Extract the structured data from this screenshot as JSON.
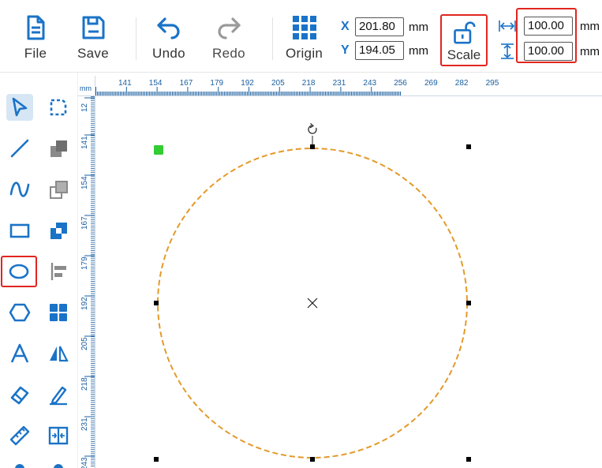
{
  "toolbar": {
    "file_label": "File",
    "save_label": "Save",
    "undo_label": "Undo",
    "redo_label": "Redo",
    "origin_label": "Origin",
    "scale_label": "Scale"
  },
  "position": {
    "x_axis": "X",
    "y_axis": "Y",
    "x_value": "201.80",
    "y_value": "194.05",
    "unit": "mm"
  },
  "size": {
    "width_value": "100.00",
    "height_value": "100.00",
    "unit": "mm"
  },
  "ruler": {
    "unit_label": "mm",
    "top_ticks": [
      "141",
      "154",
      "167",
      "179",
      "192",
      "205",
      "218",
      "231",
      "243",
      "256",
      "269",
      "282",
      "295"
    ],
    "left_ticks": [
      "12",
      "141",
      "154",
      "167",
      "179",
      "192",
      "205",
      "218",
      "231",
      "243"
    ]
  },
  "colors": {
    "accent": "#1a73c7",
    "highlight_border": "#e0261f",
    "shape_stroke": "#e39a2a",
    "anchor_marker": "#33cc33",
    "active_tool_bg": "#d7e6f5"
  },
  "tools": [
    {
      "name": "select-tool",
      "icon": "pointer-icon",
      "active": true
    },
    {
      "name": "node-edit-tool",
      "icon": "node-edit-icon",
      "active": false
    },
    {
      "name": "line-tool",
      "icon": "line-icon",
      "active": false
    },
    {
      "name": "combine-tool",
      "icon": "combine-icon",
      "active": false
    },
    {
      "name": "curve-tool",
      "icon": "curve-icon",
      "active": false
    },
    {
      "name": "subtract-tool",
      "icon": "subtract-icon",
      "active": false
    },
    {
      "name": "rectangle-tool",
      "icon": "rectangle-icon",
      "active": false
    },
    {
      "name": "intersect-tool",
      "icon": "intersect-icon",
      "active": false
    },
    {
      "name": "ellipse-tool",
      "icon": "ellipse-icon",
      "active": false
    },
    {
      "name": "align-tool",
      "icon": "align-left-icon",
      "active": false
    },
    {
      "name": "polygon-tool",
      "icon": "hexagon-icon",
      "active": false
    },
    {
      "name": "group-tool",
      "icon": "grid-icon",
      "active": false
    },
    {
      "name": "text-tool",
      "icon": "text-icon",
      "active": false
    },
    {
      "name": "mirror-tool",
      "icon": "mirror-icon",
      "active": false
    },
    {
      "name": "eraser-tool",
      "icon": "eraser-icon",
      "active": false
    },
    {
      "name": "signature-tool",
      "icon": "pen-sign-icon",
      "active": false
    },
    {
      "name": "measure-tool",
      "icon": "ruler-icon",
      "active": false
    },
    {
      "name": "fit-tool",
      "icon": "fit-frame-icon",
      "active": false
    }
  ]
}
